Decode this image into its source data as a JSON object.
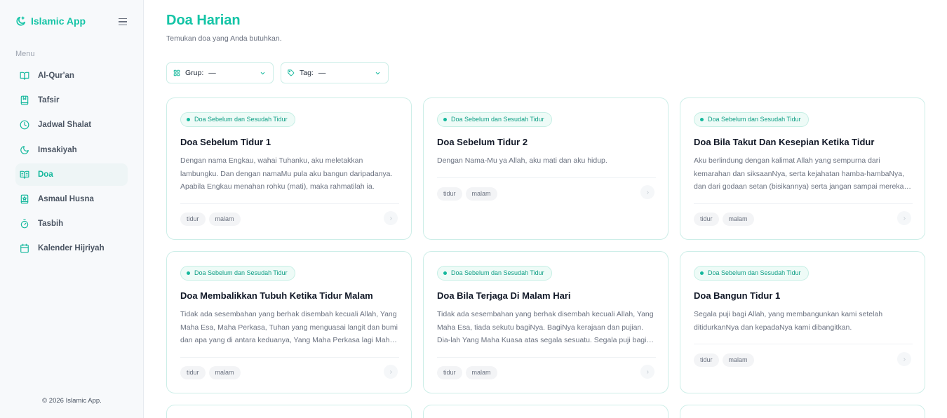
{
  "app": {
    "name": "Islamic App"
  },
  "sidebar": {
    "heading": "Menu",
    "items": [
      {
        "label": "Al-Qur'an",
        "icon": "book-open-icon"
      },
      {
        "label": "Tafsir",
        "icon": "book-bookmark-icon"
      },
      {
        "label": "Jadwal Shalat",
        "icon": "clock-icon"
      },
      {
        "label": "Imsakiyah",
        "icon": "moon-icon"
      },
      {
        "label": "Doa",
        "icon": "book-open-text-icon",
        "active": true
      },
      {
        "label": "Asmaul Husna",
        "icon": "book-star-icon"
      },
      {
        "label": "Tasbih",
        "icon": "timer-icon"
      },
      {
        "label": "Kalender Hijriyah",
        "icon": "calendar-icon"
      }
    ],
    "footer": "© 2026 Islamic App."
  },
  "page": {
    "title": "Doa Harian",
    "subtitle": "Temukan doa yang Anda butuhkan."
  },
  "filters": {
    "group": {
      "label": "Grup:",
      "value": "—"
    },
    "tag": {
      "label": "Tag:",
      "value": "—"
    }
  },
  "cards": [
    {
      "badge": "Doa Sebelum dan Sesudah Tidur",
      "title": "Doa Sebelum Tidur 1",
      "text": "Dengan nama Engkau, wahai Tuhanku, aku meletakkan lambungku. Dan dengan namaMu pula aku bangun daripadanya. Apabila Engkau menahan rohku (mati), maka rahmatilah ia.",
      "tags": [
        "tidur",
        "malam"
      ]
    },
    {
      "badge": "Doa Sebelum dan Sesudah Tidur",
      "title": "Doa Sebelum Tidur 2",
      "text": "Dengan Nama-Mu ya Allah, aku mati dan aku hidup.",
      "tags": [
        "tidur",
        "malam"
      ]
    },
    {
      "badge": "Doa Sebelum dan Sesudah Tidur",
      "title": "Doa Bila Takut Dan Kesepian Ketika Tidur",
      "text": "Aku berlindung dengan kalimat Allah yang sempurna dari kemarahan dan siksaanNya, serta kejahatan hamba-hambaNya, dan dari godaan setan (bisikannya) serta jangan sampai mereka datang kepadaku.",
      "tags": [
        "tidur",
        "malam"
      ]
    },
    {
      "badge": "Doa Sebelum dan Sesudah Tidur",
      "title": "Doa Membalikkan Tubuh Ketika Tidur Malam",
      "text": "Tidak ada sesembahan yang berhak disembah kecuali Allah, Yang Maha Esa, Maha Perkasa, Tuhan yang menguasai langit dan bumi dan apa yang di antara keduanya, Yang Maha Perkasa lagi Maha Pengampun.",
      "tags": [
        "tidur",
        "malam"
      ]
    },
    {
      "badge": "Doa Sebelum dan Sesudah Tidur",
      "title": "Doa Bila Terjaga Di Malam Hari",
      "text": "Tidak ada sesembahan yang berhak disembah kecuali Allah, Yang Maha Esa, tiada sekutu bagiNya. BagiNya kerajaan dan pujian. Dia-lah Yang Maha Kuasa atas segala sesuatu. Segala puji bagi Allah.",
      "tags": [
        "tidur",
        "malam"
      ]
    },
    {
      "badge": "Doa Sebelum dan Sesudah Tidur",
      "title": "Doa Bangun Tidur 1",
      "text": "Segala puji bagi Allah, yang membangunkan kami setelah ditidurkanNya dan kepadaNya kami dibangitkan.",
      "tags": [
        "tidur",
        "malam"
      ]
    }
  ],
  "colors": {
    "accent": "#14c4a6",
    "border": "#cdeee8",
    "sidebar_bg": "#f7f9fb"
  }
}
